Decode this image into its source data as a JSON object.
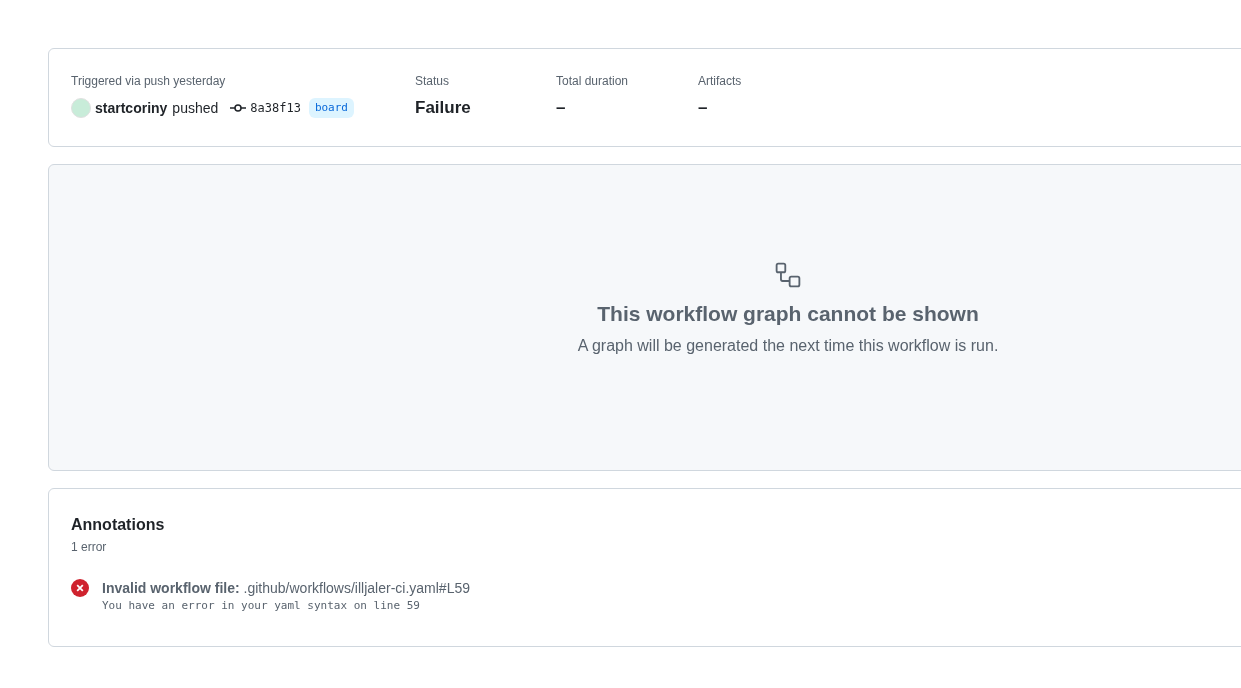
{
  "summary": {
    "trigger": "Triggered via push yesterday",
    "actor": "startcoriny",
    "action": "pushed",
    "commit": "8a38f13",
    "branch": "board",
    "fields": [
      {
        "label": "Status",
        "value": "Failure"
      },
      {
        "label": "Total duration",
        "value": "–"
      },
      {
        "label": "Artifacts",
        "value": "–"
      }
    ]
  },
  "graph": {
    "title": "This workflow graph cannot be shown",
    "message": "A graph will be generated the next time this workflow is run."
  },
  "annotations": {
    "title": "Annotations",
    "count": "1 error",
    "items": [
      {
        "kind": "error",
        "title": "**Invalid workflow file:** .github/workflows/illjaler-ci.yaml#L59",
        "detail": "You have an error in your yaml syntax on line 59"
      }
    ]
  }
}
